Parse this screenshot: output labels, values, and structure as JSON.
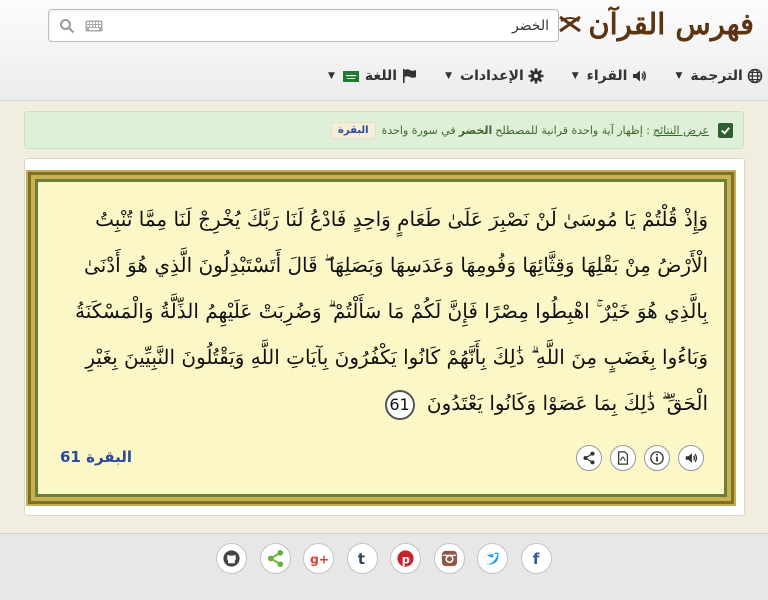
{
  "header": {
    "logo_text": "فهرس القرآن",
    "search": {
      "value": "الخضر",
      "placeholder": ""
    },
    "nav": [
      {
        "label": "الترجمة",
        "icon": "globe-icon"
      },
      {
        "label": "القراء",
        "icon": "speaker-icon"
      },
      {
        "label": "الإعدادات",
        "icon": "gear-icon"
      },
      {
        "label": "اللغة",
        "icon": "flag-icon"
      }
    ]
  },
  "alert": {
    "label": "عرض النتائج",
    "text_before": ": إظهار آية واحدة قرانية للمصطلح",
    "term": "الخضر",
    "text_after": "في سورة واحدة",
    "badge": "البقرة"
  },
  "verse": {
    "text": "وَإِذْ قُلْتُمْ يَا مُوسَىٰ لَنْ نَصْبِرَ عَلَىٰ طَعَامٍ وَاحِدٍ فَادْعُ لَنَا رَبَّكَ يُخْرِجْ لَنَا مِمَّا تُنْبِتُ الْأَرْضُ مِنْ بَقْلِهَا وَقِثَّائِهَا وَفُومِهَا وَعَدَسِهَا وَبَصَلِهَا ۖ قَالَ أَتَسْتَبْدِلُونَ الَّذِي هُوَ أَدْنَىٰ بِالَّذِي هُوَ خَيْرٌ ۚ اهْبِطُوا مِصْرًا فَإِنَّ لَكُمْ مَا سَأَلْتُمْ ۗ وَضُرِبَتْ عَلَيْهِمُ الذِّلَّةُ وَالْمَسْكَنَةُ وَبَاءُوا بِغَضَبٍ مِنَ اللَّهِ ۗ ذَٰلِكَ بِأَنَّهُمْ كَانُوا يَكْفُرُونَ بِآيَاتِ اللَّهِ وَيَقْتُلُونَ النَّبِيِّينَ بِغَيْرِ الْحَقِّ ۗ ذَٰلِكَ بِمَا عَصَوْا وَكَانُوا يَعْتَدُونَ",
    "number": "61",
    "reference": "البقرة 61"
  },
  "colors": {
    "brand": "#5c3410",
    "reference": "#2c4a99",
    "alert_bg": "#dff0d8"
  }
}
